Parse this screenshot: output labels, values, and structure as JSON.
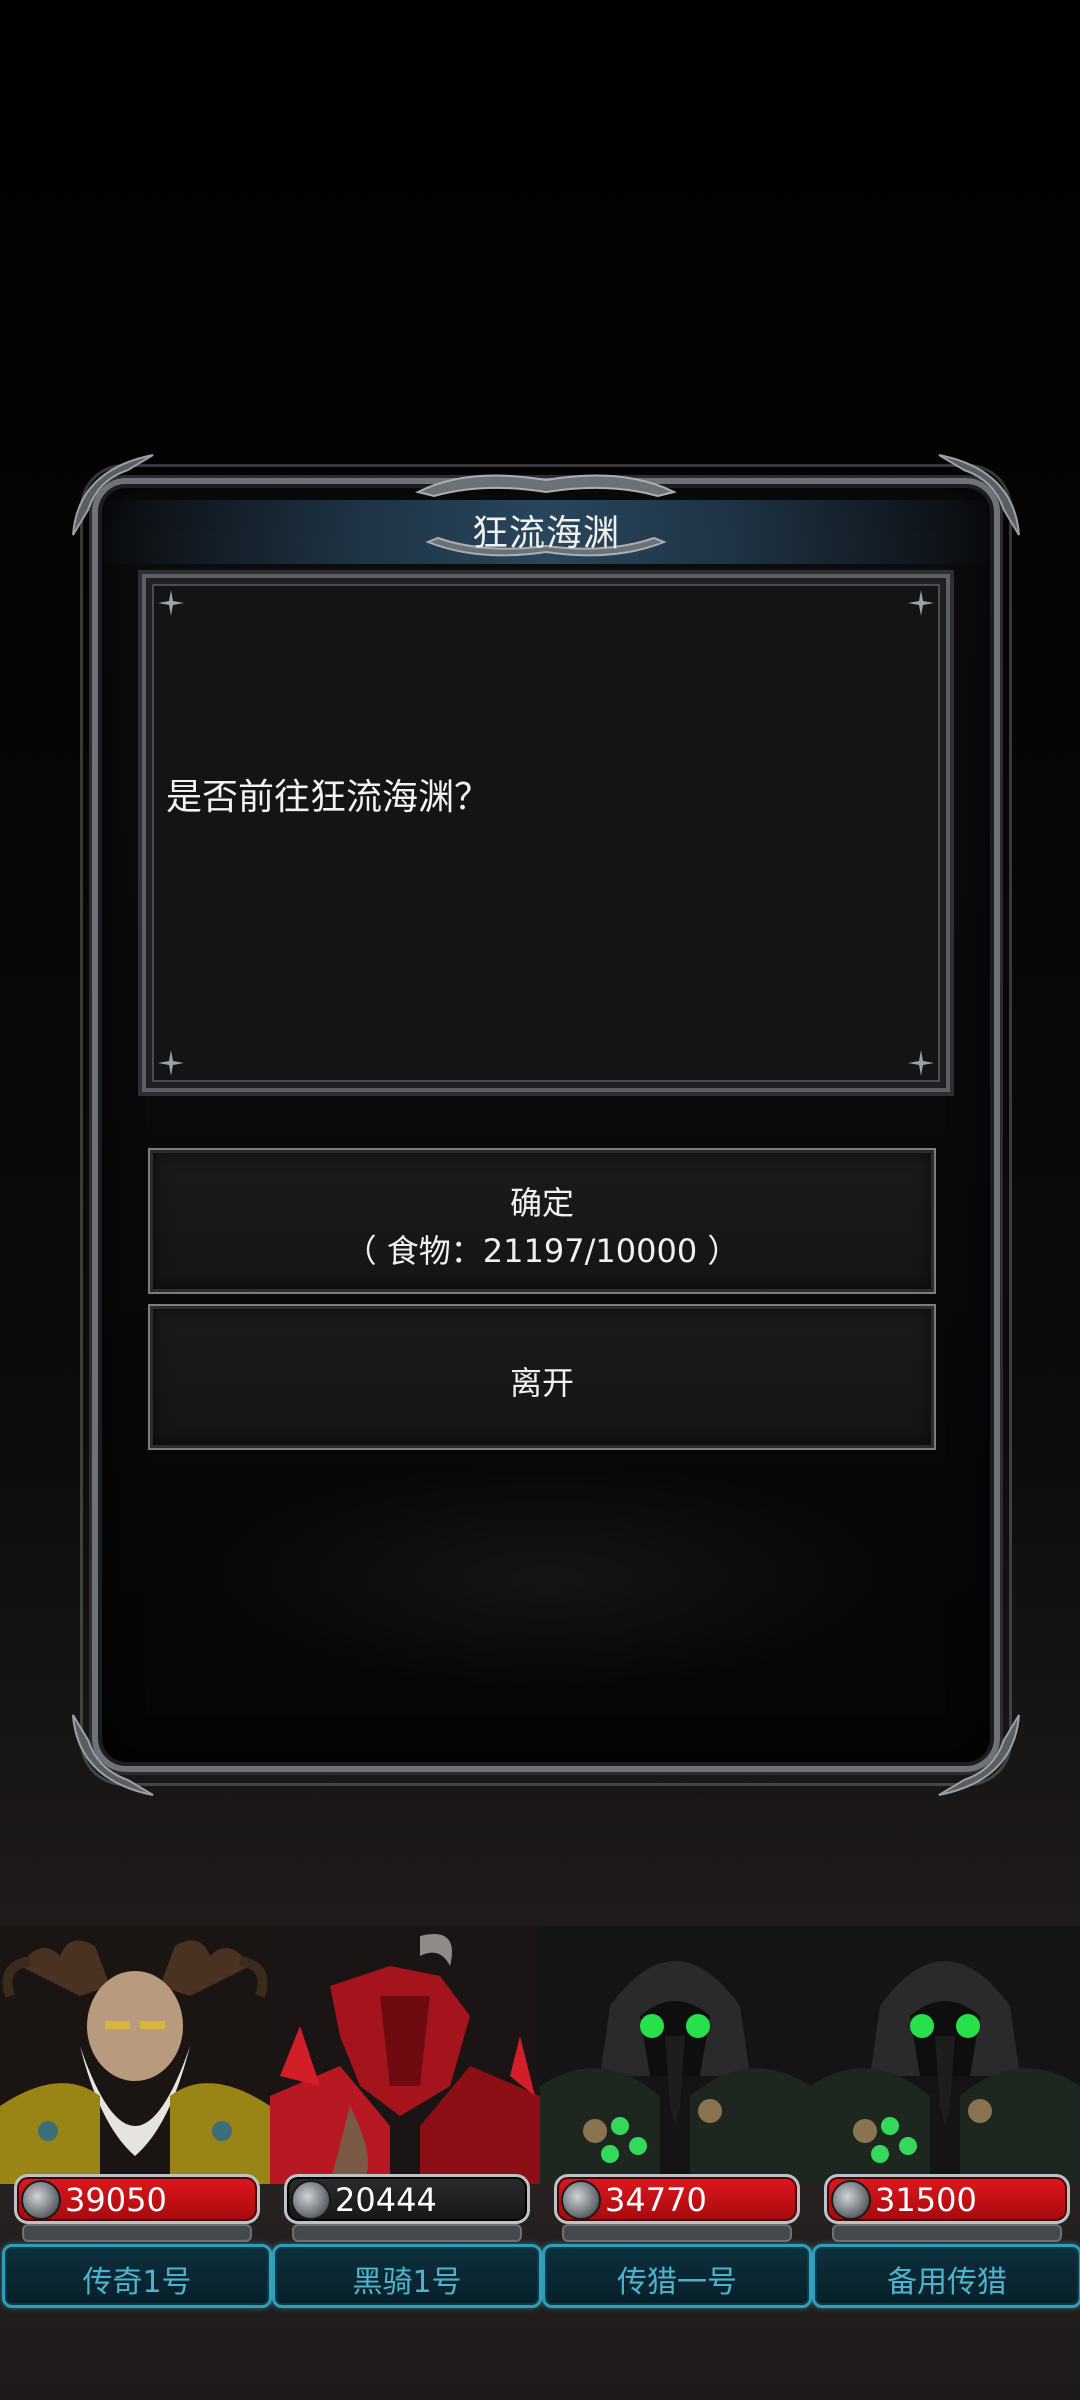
{
  "dialog": {
    "title": "狂流海渊",
    "message": "是否前往狂流海渊？",
    "confirm": {
      "label": "确定",
      "cost_text": "（ 食物：21197/10000 ）"
    },
    "leave_label": "离开"
  },
  "party": [
    {
      "name": "传奇1号",
      "power": "39050",
      "bar": "red"
    },
    {
      "name": "黑骑1号",
      "power": "20444",
      "bar": "dark"
    },
    {
      "name": "传猎一号",
      "power": "34770",
      "bar": "red"
    },
    {
      "name": "备用传猎",
      "power": "31500",
      "bar": "red"
    }
  ],
  "icons": {
    "power": "sword-icon",
    "panel_corner": "sparkle-icon"
  }
}
